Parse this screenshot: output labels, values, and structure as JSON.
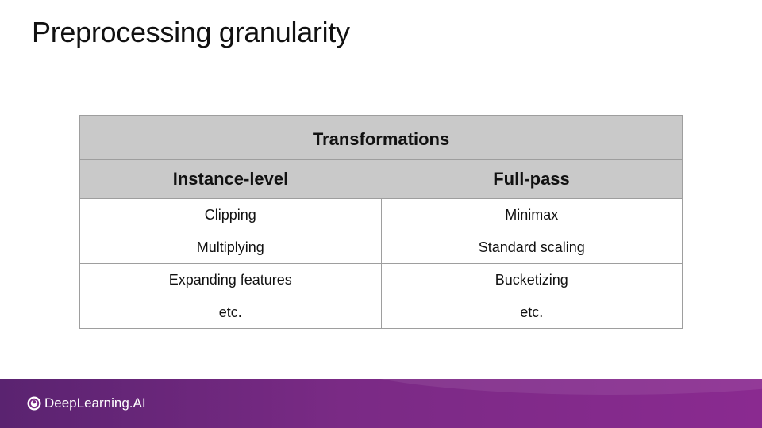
{
  "slide": {
    "title": "Preprocessing granularity"
  },
  "table": {
    "group_header": "Transformations",
    "columns": [
      "Instance-level",
      "Full-pass"
    ],
    "rows": [
      [
        "Clipping",
        "Minimax"
      ],
      [
        "Multiplying",
        "Standard scaling"
      ],
      [
        "Expanding features",
        "Bucketizing"
      ],
      [
        "etc.",
        "etc."
      ]
    ]
  },
  "footer": {
    "brand": "DeepLearning.AI",
    "logo_icon": "deeplearning-ai-logo-icon",
    "gradient_colors": [
      "#5a2370",
      "#8a2a90"
    ]
  }
}
